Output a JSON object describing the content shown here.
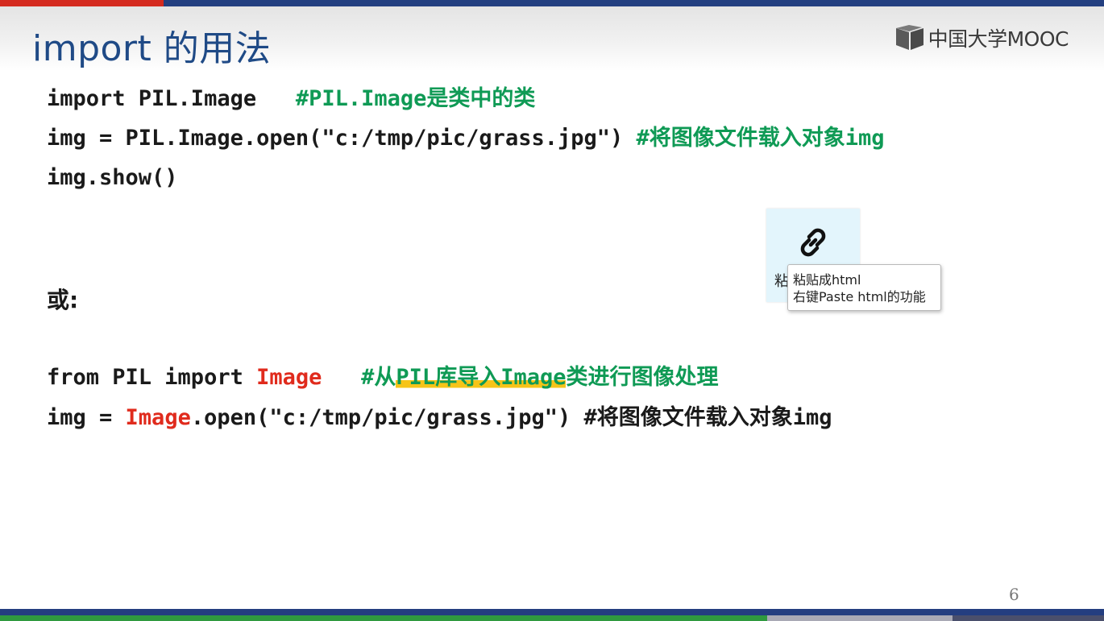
{
  "slide": {
    "title": "import 的用法",
    "logo_text": "中国大学MOOC",
    "page_number": "6"
  },
  "code_block_1": {
    "line1_code": "import PIL.Image   ",
    "line1_comment": "#PIL.Image是类中的类",
    "line2_code": "img = PIL.Image.open(\"c:/tmp/pic/grass.jpg\") ",
    "line2_comment": "#将图像文件载入对象img",
    "line3_code": "img.show()"
  },
  "or_label": "或:",
  "code_block_2": {
    "line1_prefix": "from PIL import ",
    "line1_image": "Image",
    "line1_spacing": "   ",
    "line1_comment_hash": "#从",
    "line1_comment_highlight": "PIL库导入Image",
    "line1_comment_rest": "类进行图像处理",
    "line2_prefix": "img = ",
    "line2_image": "Image",
    "line2_rest": ".open(\"c:/tmp/pic/grass.jpg\") ",
    "line2_comment": "#将图像文件载入对象img"
  },
  "paste_widget": {
    "icon": "link-icon",
    "label": "粘贴成html",
    "background": "#e3f5fc"
  },
  "tooltip": {
    "line1": "粘贴成html",
    "line2": "右键Paste html的功能"
  },
  "colors": {
    "title": "#1f4a86",
    "comment_green": "#0f9a55",
    "keyword_red": "#e02b1d",
    "highlight_yellow": "#f6c418",
    "top_bar_red": "#d42a1f",
    "top_bar_blue": "#233f80",
    "bottom_green": "#2f9a3f"
  }
}
